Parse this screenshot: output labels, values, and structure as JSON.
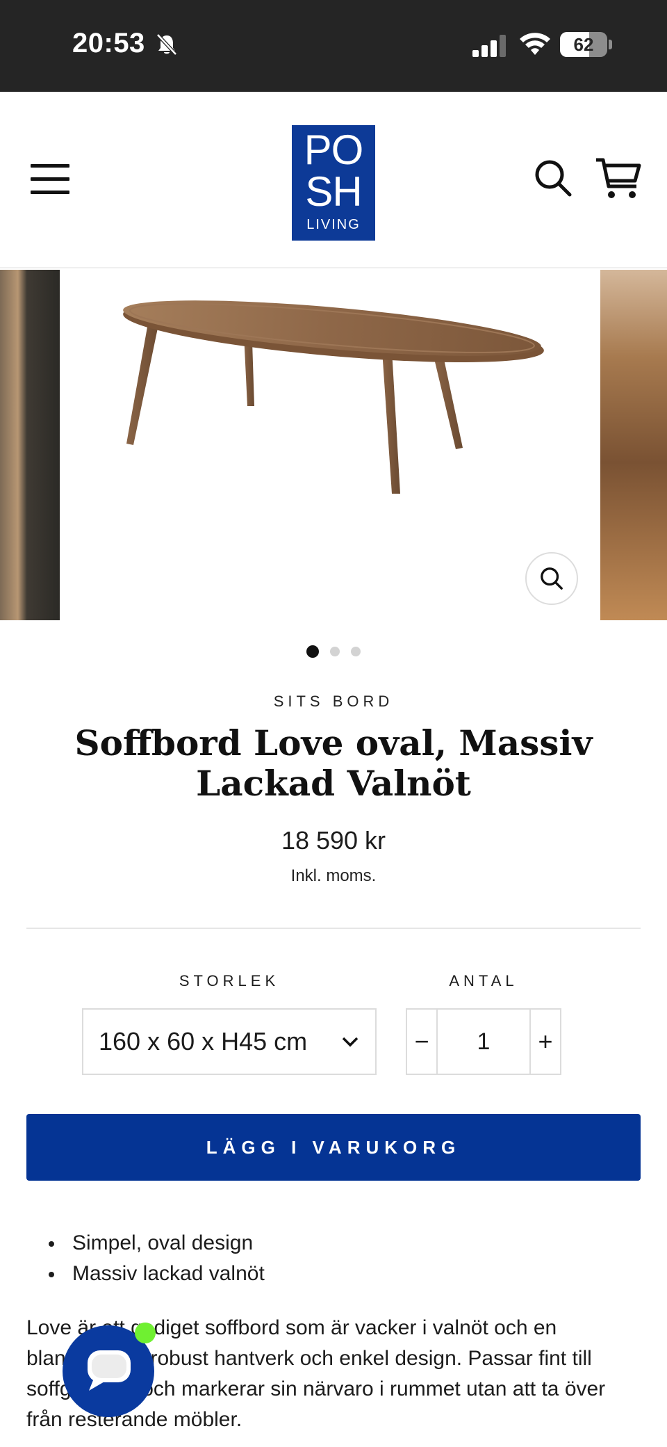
{
  "status_bar": {
    "time": "20:53",
    "battery": "62",
    "battery_level": 0.62
  },
  "header": {
    "logo_line1": "PO",
    "logo_line2": "SH",
    "logo_line3": "LIVING",
    "menu_icon": "hamburger-menu-icon",
    "search_icon": "search-icon",
    "cart_icon": "cart-icon"
  },
  "gallery": {
    "slide_count": 3,
    "active_slide": 1,
    "zoom_icon": "zoom-icon"
  },
  "product": {
    "vendor": "SITS BORD",
    "title": "Soffbord Love oval, Massiv Lackad Valnöt",
    "price": "18 590 kr",
    "tax_note": "Inkl. moms."
  },
  "options": {
    "size_label": "STORLEK",
    "size_value": "160 x 60 x H45 cm",
    "qty_label": "ANTAL",
    "qty_value": "1",
    "minus": "−",
    "plus": "+"
  },
  "cta": {
    "add_to_cart": "LÄGG I VARUKORG"
  },
  "features": [
    "Simpel, oval design",
    "Massiv lackad valnöt"
  ],
  "description": "Love är ett gediget soffbord som är vacker i valnöt och en blandning av robust hantverk och enkel design. Passar fint till soffgruppen och markerar sin närvaro i rummet utan att ta över från resterande möbler.",
  "colors": {
    "brand_blue": "#053494",
    "logo_blue": "#0d3a97",
    "status_bar": "#252525",
    "online_green": "#6ff031"
  }
}
